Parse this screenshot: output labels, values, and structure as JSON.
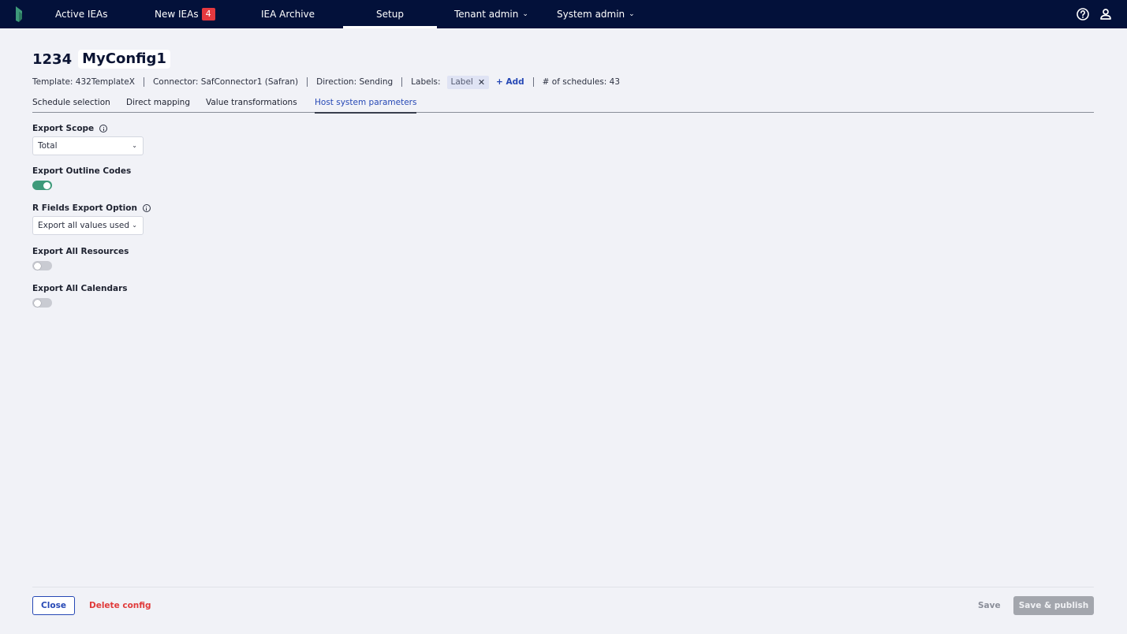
{
  "nav": {
    "items": [
      {
        "label": "Active IEAs"
      },
      {
        "label": "New IEAs",
        "badge": "4"
      },
      {
        "label": "IEA Archive"
      },
      {
        "label": "Setup"
      },
      {
        "label": "Tenant admin"
      },
      {
        "label": "System admin"
      }
    ],
    "active": "Setup",
    "icons": [
      "app-logo",
      "help-icon",
      "user-icon"
    ]
  },
  "config": {
    "id": "1234",
    "name": "MyConfig1"
  },
  "meta": {
    "template": "Template: 432TemplateX",
    "connector": "Connector: SafConnector1 (Safran)",
    "direction": "Direction: Sending",
    "labels_label": "Labels:",
    "label_chip": "Label",
    "add_label": "+ Add",
    "schedules": "# of schedules: 43"
  },
  "tabs": [
    {
      "label": "Schedule selection"
    },
    {
      "label": "Direct mapping"
    },
    {
      "label": "Value transformations"
    },
    {
      "label": "Host system parameters"
    }
  ],
  "active_tab": "Host system parameters",
  "form": {
    "export_scope": {
      "label": "Export Scope",
      "value": "Total"
    },
    "export_outline_codes": {
      "label": "Export Outline Codes",
      "enabled": true
    },
    "r_fields_export_option": {
      "label": "R Fields Export Option",
      "value": "Export all values used"
    },
    "export_all_resources": {
      "label": "Export All Resources",
      "enabled": false
    },
    "export_all_calendars": {
      "label": "Export All Calendars",
      "enabled": false
    }
  },
  "footer": {
    "close": "Close",
    "delete": "Delete config",
    "save": "Save",
    "save_publish": "Save & publish"
  },
  "colors": {
    "nav_bg": "#03113a",
    "accent": "#2648b5",
    "toggle_on": "#3e9a7a",
    "danger": "#e03a3a",
    "badge": "#e5393f"
  }
}
